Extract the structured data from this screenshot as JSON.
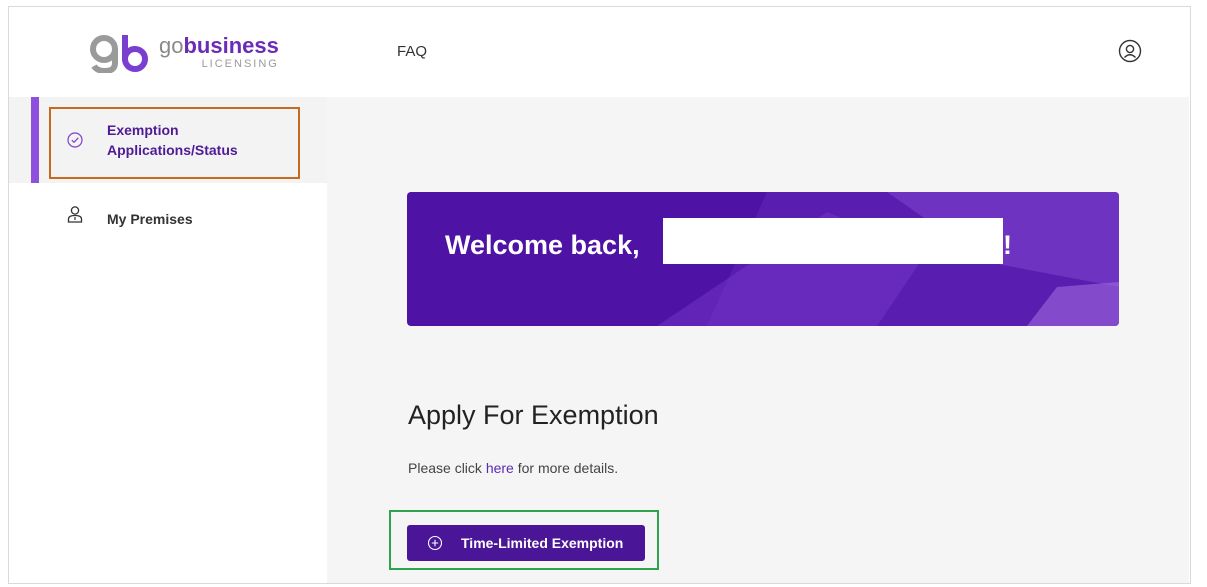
{
  "header": {
    "logo": {
      "brand_prefix": "go",
      "brand_main": "business",
      "brand_sub": "LICENSING"
    },
    "nav": {
      "faq_label": "FAQ"
    },
    "profile_icon": "user-circle-icon"
  },
  "sidebar": {
    "items": [
      {
        "label_line1": "Exemption",
        "label_line2": "Applications/Status",
        "icon": "check-circle-icon",
        "active": true
      },
      {
        "label": "My Premises",
        "icon": "person-icon",
        "active": false
      }
    ]
  },
  "main": {
    "banner": {
      "welcome_text": "Welcome back,",
      "suffix": "!"
    },
    "apply": {
      "title": "Apply For Exemption",
      "desc_prefix": "Please click ",
      "desc_link": "here",
      "desc_suffix": " for more details.",
      "button_label": "Time-Limited Exemption",
      "button_icon": "plus-circle-icon"
    }
  },
  "colors": {
    "brand_purple": "#4e12a4",
    "accent_purple": "#8e4fdc",
    "active_outline": "#c56a1f",
    "button_outline": "#2ea44f"
  }
}
